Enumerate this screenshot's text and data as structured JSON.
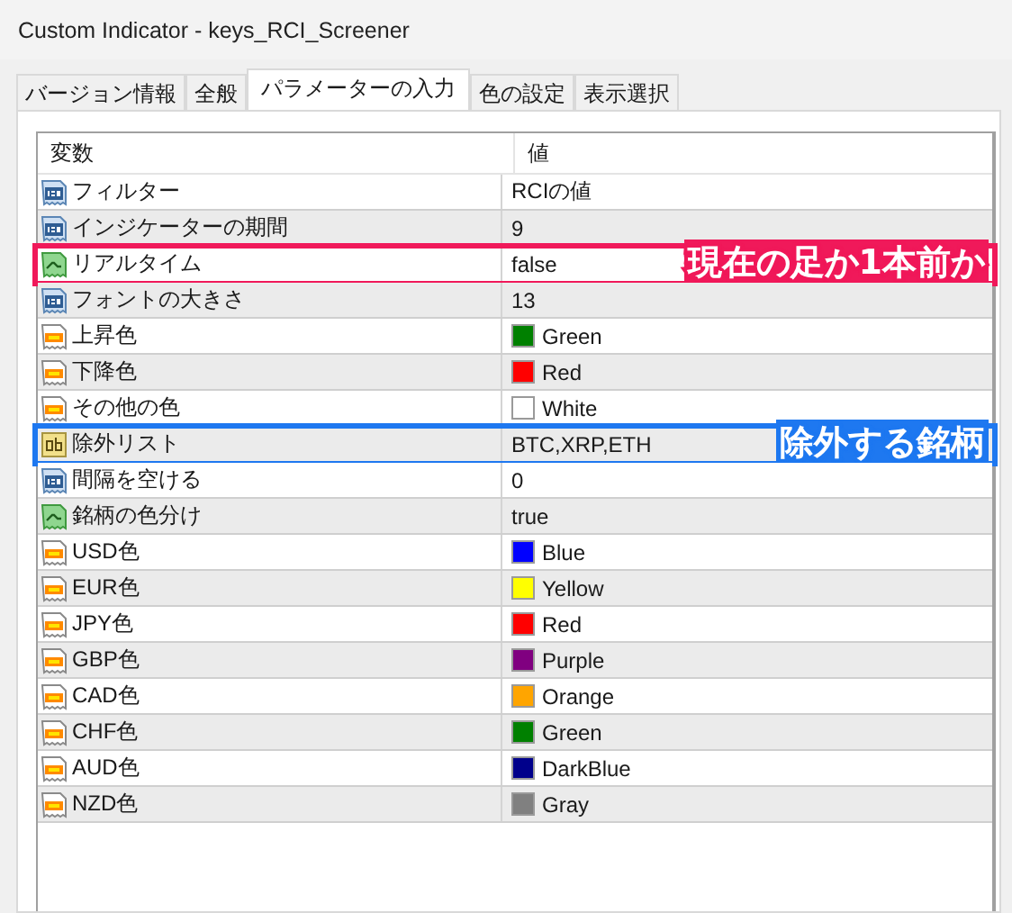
{
  "window": {
    "title": "Custom Indicator - keys_RCI_Screener"
  },
  "tabs": [
    {
      "label": "バージョン情報",
      "selected": false
    },
    {
      "label": "全般",
      "selected": false
    },
    {
      "label": "パラメーターの入力",
      "selected": true
    },
    {
      "label": "色の設定",
      "selected": false
    },
    {
      "label": "表示選択",
      "selected": false
    }
  ],
  "table": {
    "columns": [
      "変数",
      "値"
    ],
    "rows": [
      {
        "kind": "number",
        "name": "フィルター",
        "value": "RCIの値"
      },
      {
        "kind": "number",
        "name": "インジケーターの期間",
        "value": "9"
      },
      {
        "kind": "bool",
        "name": "リアルタイム",
        "value": "false",
        "annotation": {
          "text": "現在の足か1本前か",
          "color": "#f0195a"
        }
      },
      {
        "kind": "number",
        "name": "フォントの大きさ",
        "value": "13"
      },
      {
        "kind": "color",
        "name": "上昇色",
        "value": "Green",
        "color": "#008000"
      },
      {
        "kind": "color",
        "name": "下降色",
        "value": "Red",
        "color": "#ff0000"
      },
      {
        "kind": "color",
        "name": "その他の色",
        "value": "White",
        "color": "#ffffff"
      },
      {
        "kind": "string",
        "name": "除外リスト",
        "value": "BTC,XRP,ETH",
        "annotation": {
          "text": "除外する銘柄",
          "color": "#1e78f0"
        }
      },
      {
        "kind": "number",
        "name": "間隔を空ける",
        "value": "0"
      },
      {
        "kind": "bool",
        "name": "銘柄の色分け",
        "value": "true"
      },
      {
        "kind": "color",
        "name": "USD色",
        "value": "Blue",
        "color": "#0000ff"
      },
      {
        "kind": "color",
        "name": "EUR色",
        "value": "Yellow",
        "color": "#ffff00"
      },
      {
        "kind": "color",
        "name": "JPY色",
        "value": "Red",
        "color": "#ff0000"
      },
      {
        "kind": "color",
        "name": "GBP色",
        "value": "Purple",
        "color": "#800080"
      },
      {
        "kind": "color",
        "name": "CAD色",
        "value": "Orange",
        "color": "#ffa500"
      },
      {
        "kind": "color",
        "name": "CHF色",
        "value": "Green",
        "color": "#008000"
      },
      {
        "kind": "color",
        "name": "AUD色",
        "value": "DarkBlue",
        "color": "#00008b"
      },
      {
        "kind": "color",
        "name": "NZD色",
        "value": "Gray",
        "color": "#808080"
      }
    ]
  }
}
